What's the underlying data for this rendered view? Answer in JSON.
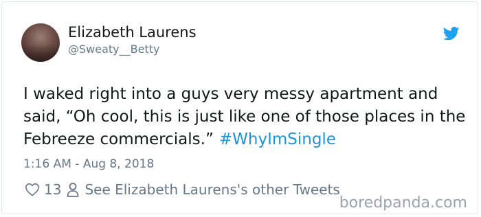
{
  "tweet": {
    "author_name": "Elizabeth Laurens",
    "author_handle": "@Sweaty__Betty",
    "text": "I waked right into a guys very messy apartment and said, “Oh cool, this is just like one of those places in the Febreeze commercials.”",
    "hashtag": "#WhyImSingle",
    "timestamp": "1:16 AM - Aug 8, 2018",
    "like_count": "13",
    "other_tweets_link": "See Elizabeth Laurens's other Tweets"
  },
  "icons": {
    "logo": "twitter-bird-icon",
    "like": "heart-icon",
    "profile": "person-icon"
  },
  "watermark": {
    "text": "boredpanda.com"
  },
  "colors": {
    "brand": "#1da1f2",
    "hashtag": "#1b95e0",
    "secondary_text": "#657786",
    "primary_text": "#14171a",
    "border": "#e1e8ed"
  }
}
